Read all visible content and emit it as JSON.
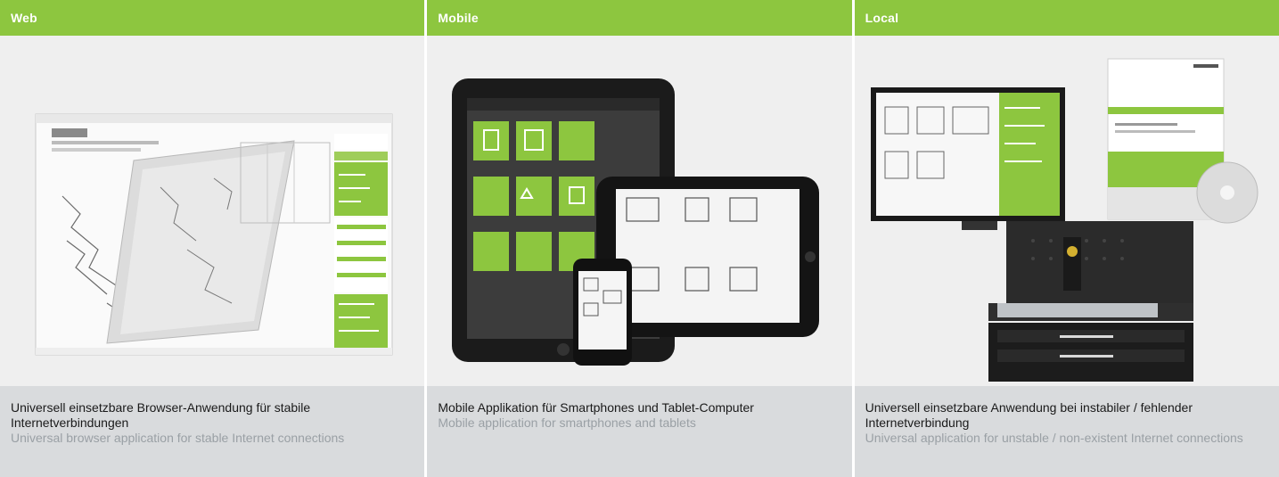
{
  "columns": [
    {
      "title": "Web",
      "caption_de": "Universell einsetzbare Browser-Anwendung für stabile Internetverbindungen",
      "caption_en": "Universal browser application for stable Internet connections"
    },
    {
      "title": "Mobile",
      "caption_de": "Mobile Applikation für Smartphones und Tablet-Computer",
      "caption_en": "Mobile application for smartphones and tablets"
    },
    {
      "title": "Local",
      "caption_de": "Universell einsetzbare Anwendung bei instabiler / fehlender Internetverbindung",
      "caption_en": "Universal application for unstable / non-existent Internet connections"
    }
  ],
  "colors": {
    "header_green": "#8dc63f",
    "caption_bg": "#d9dbdd",
    "image_bg": "#efefef"
  }
}
